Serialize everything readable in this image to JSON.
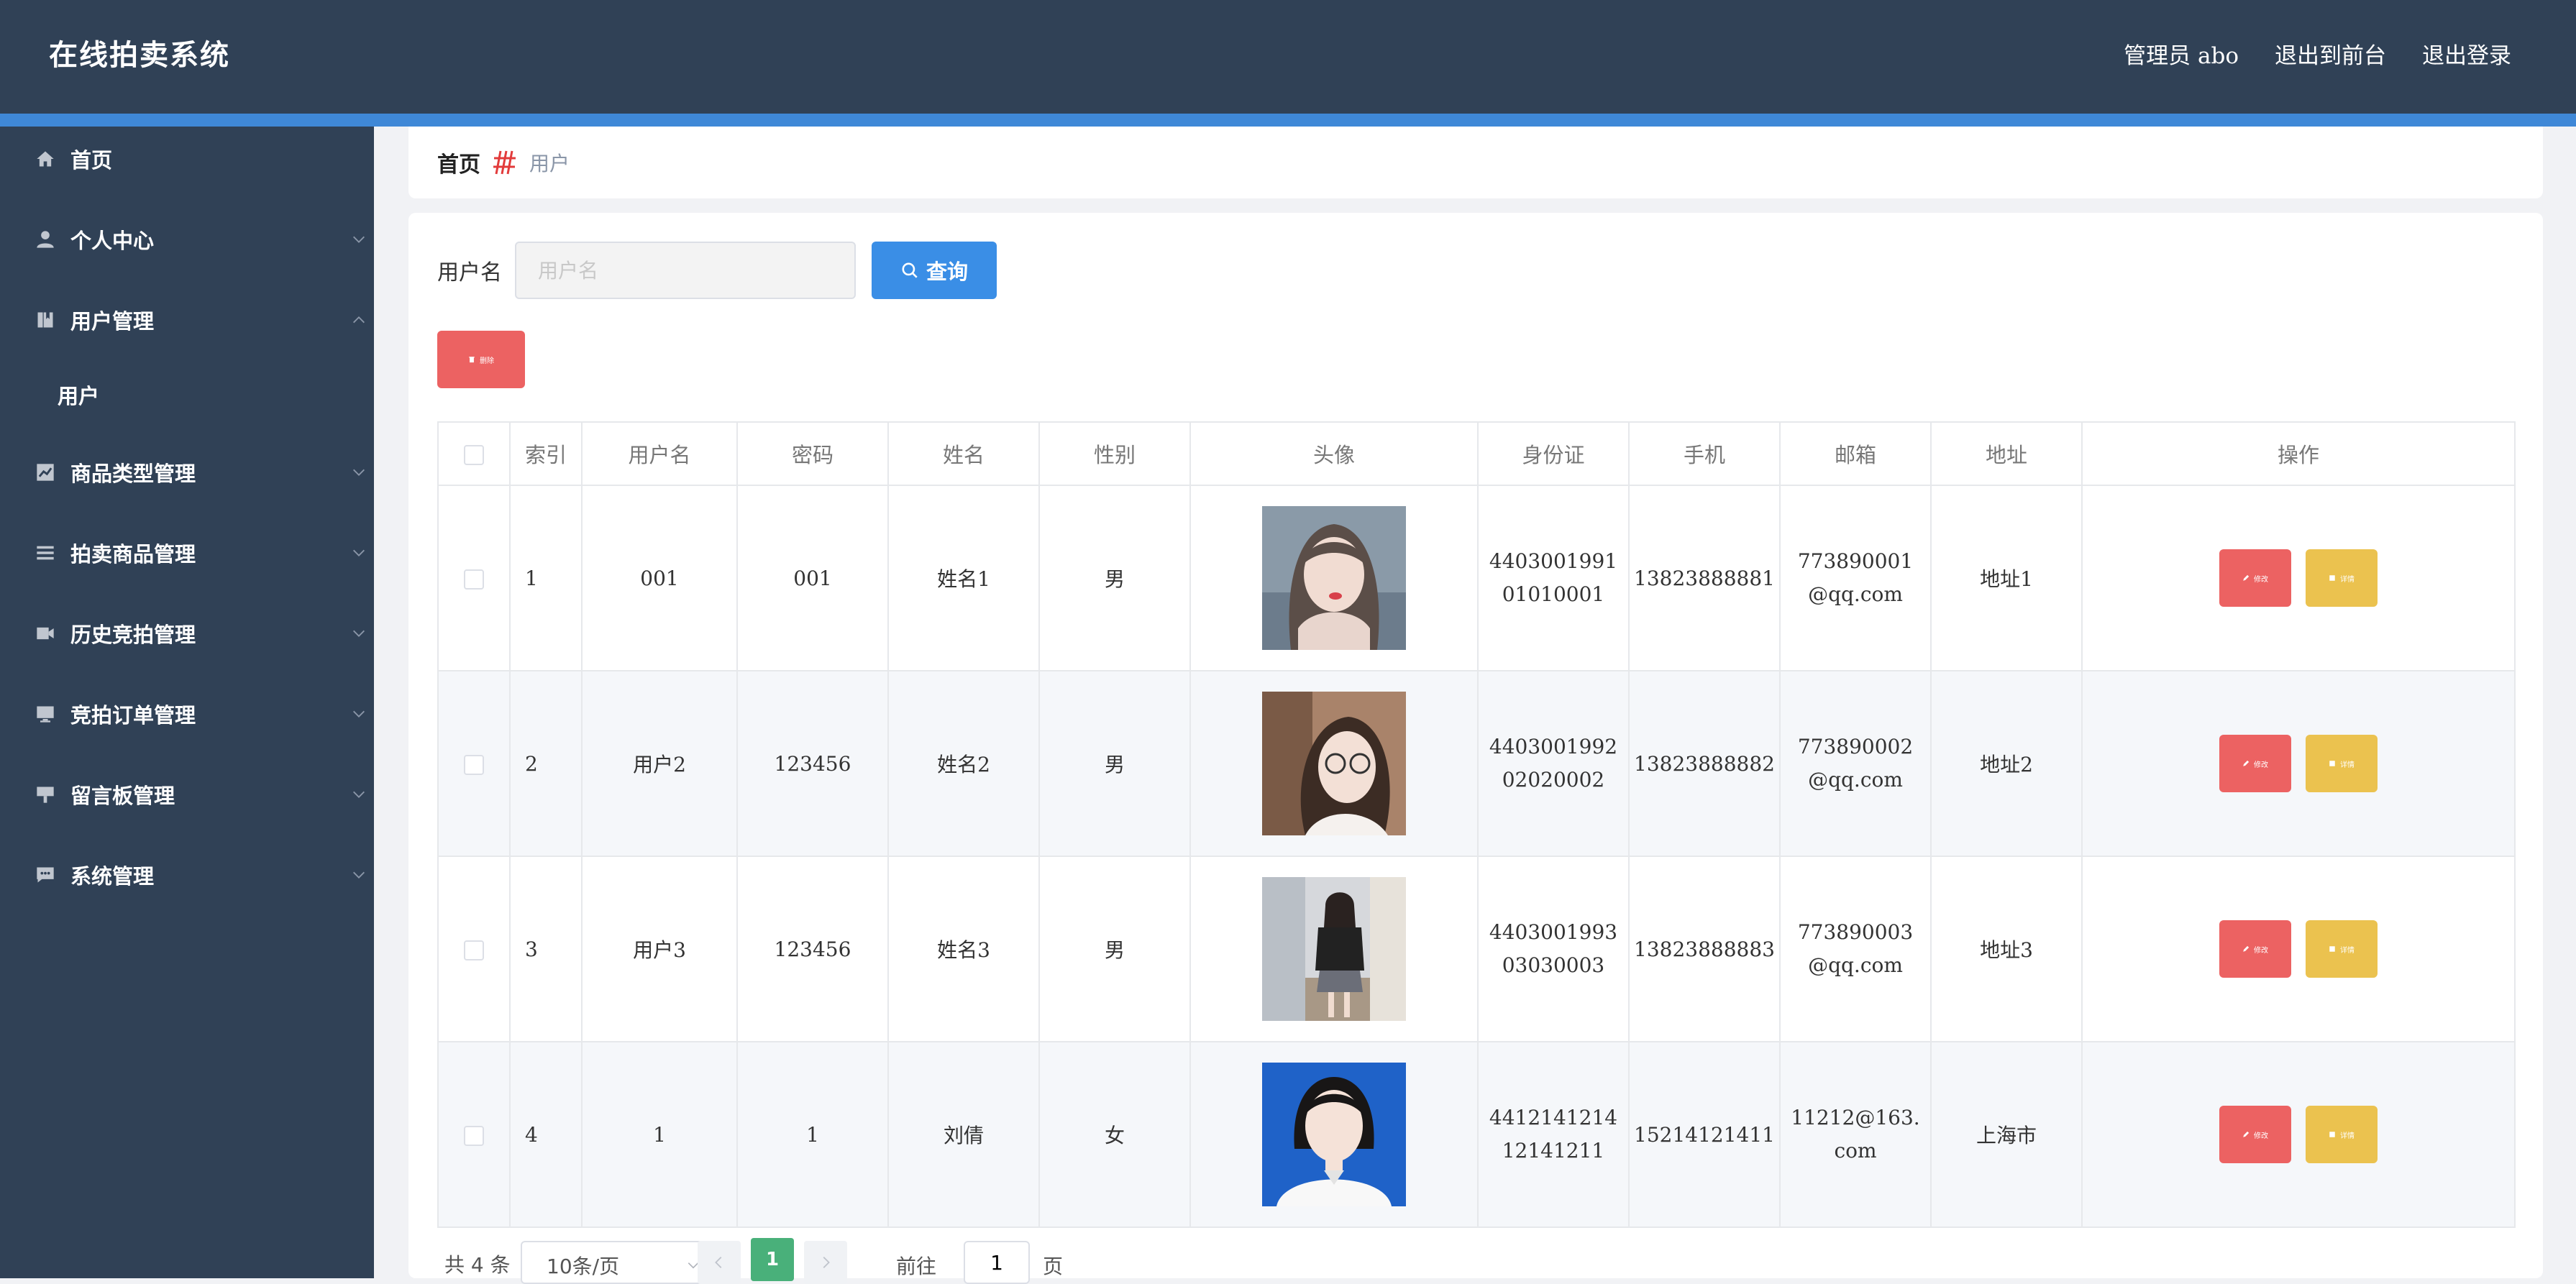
{
  "header": {
    "brand": "在线拍卖系统",
    "admin": "管理员 abo",
    "to_front": "退出到前台",
    "logout": "退出登录"
  },
  "sidebar": {
    "items": [
      {
        "label": "首页",
        "icon": "home-icon"
      },
      {
        "label": "个人中心",
        "icon": "person-icon"
      },
      {
        "label": "用户管理",
        "icon": "bookmark-icon"
      },
      {
        "label": "商品类型管理",
        "icon": "chart-icon"
      },
      {
        "label": "拍卖商品管理",
        "icon": "list-icon"
      },
      {
        "label": "历史竞拍管理",
        "icon": "film-icon"
      },
      {
        "label": "竞拍订单管理",
        "icon": "monitor-icon"
      },
      {
        "label": "留言板管理",
        "icon": "board-icon"
      },
      {
        "label": "系统管理",
        "icon": "message-icon"
      }
    ],
    "sub_item": "用户"
  },
  "breadcrumb": {
    "home": "首页",
    "current": "用户"
  },
  "search": {
    "label": "用户名",
    "placeholder": "用户名",
    "button": "查询"
  },
  "toolbar": {
    "delete_label": "删除"
  },
  "table": {
    "headers": [
      "",
      "索引",
      "用户名",
      "密码",
      "姓名",
      "性别",
      "头像",
      "身份证",
      "手机",
      "邮箱",
      "地址",
      "操作"
    ],
    "rows": [
      {
        "index": "1",
        "username": "001",
        "password": "001",
        "name": "姓名1",
        "gender": "男",
        "id_card": "440300199101010001",
        "phone": "13823888881",
        "email": "773890001@qq.com",
        "address": "地址1"
      },
      {
        "index": "2",
        "username": "用户2",
        "password": "123456",
        "name": "姓名2",
        "gender": "男",
        "id_card": "440300199202020002",
        "phone": "13823888882",
        "email": "773890002@qq.com",
        "address": "地址2"
      },
      {
        "index": "3",
        "username": "用户3",
        "password": "123456",
        "name": "姓名3",
        "gender": "男",
        "id_card": "440300199303030003",
        "phone": "13823888883",
        "email": "773890003@qq.com",
        "address": "地址3"
      },
      {
        "index": "4",
        "username": "1",
        "password": "1",
        "name": "刘倩",
        "gender": "女",
        "id_card": "441214121412141211",
        "phone": "15214121411",
        "email": "11212@163.com",
        "address": "上海市"
      }
    ],
    "edit_label": "修改",
    "detail_label": "详情"
  },
  "pagination": {
    "total": "共 4 条",
    "page_size": "10条/页",
    "current_page": "1",
    "goto_label": "前往",
    "goto_value": "1",
    "page_suffix": "页"
  },
  "colors": {
    "header_bg": "#304156",
    "accent_line": "#3f88d7",
    "query_btn": "#3a8ee6",
    "danger": "#ec6262",
    "warning": "#ebc24f",
    "page_active": "#49b07a"
  }
}
